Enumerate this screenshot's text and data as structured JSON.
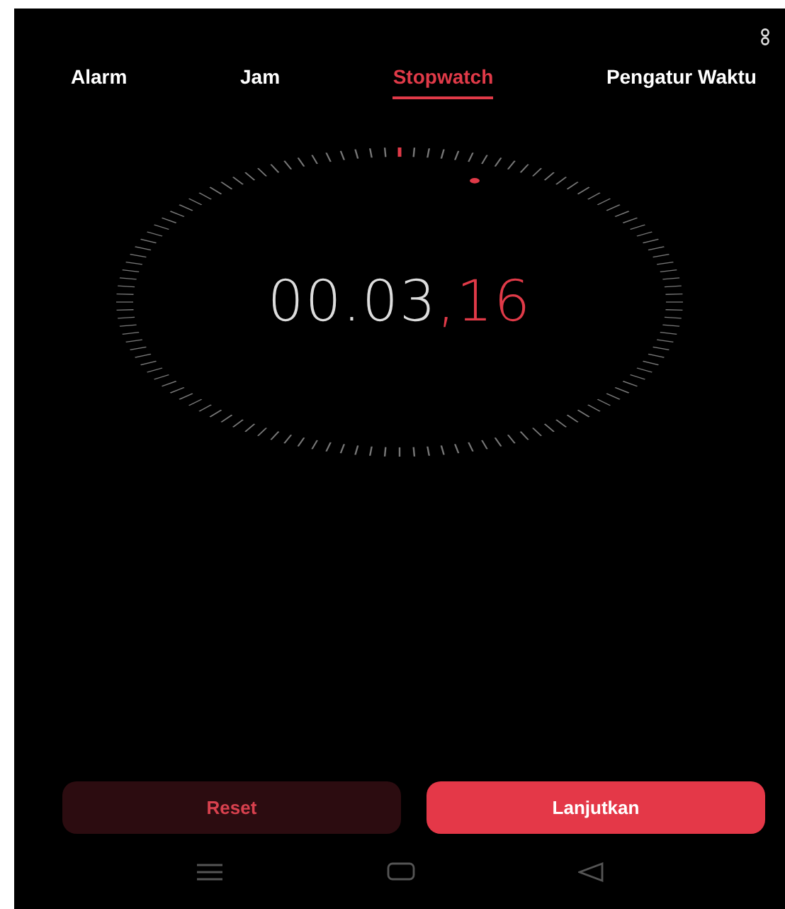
{
  "tabs": [
    {
      "label": "Alarm",
      "selected": false
    },
    {
      "label": "Jam",
      "selected": false
    },
    {
      "label": "Stopwatch",
      "selected": true
    },
    {
      "label": "Pengatur Waktu",
      "selected": false
    }
  ],
  "stopwatch": {
    "time": "00.03",
    "hundredths": ",16"
  },
  "buttons": [
    {
      "label": "Reset",
      "kind": "secondary"
    },
    {
      "label": "Lanjutkan",
      "kind": "primary"
    }
  ]
}
